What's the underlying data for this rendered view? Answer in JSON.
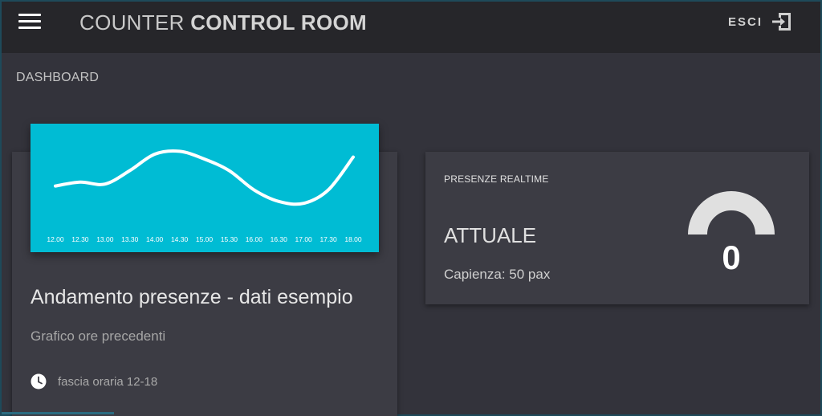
{
  "header": {
    "title_light": "COUNTER",
    "title_bold": "CONTROL ROOM",
    "logout_label": "ESCI"
  },
  "breadcrumb": "DASHBOARD",
  "chart_card": {
    "title": "Andamento presenze - dati esempio",
    "subtitle": "Grafico ore precedenti",
    "footer": "fascia oraria 12-18"
  },
  "realtime_card": {
    "label": "PRESENZE REALTIME",
    "heading": "ATTUALE",
    "capacity": "Capienza: 50 pax",
    "gauge_value": "0",
    "gauge_fraction": 0
  },
  "colors": {
    "accent": "#00bcd4",
    "background": "#33333b",
    "card": "#3c3c44",
    "topbar": "#26262a"
  },
  "chart_data": {
    "type": "line",
    "categories": [
      "12.00",
      "12.30",
      "13.00",
      "13.30",
      "14.00",
      "14.30",
      "15.00",
      "15.30",
      "16.00",
      "16.30",
      "17.00",
      "17.30",
      "18.00"
    ],
    "series": [
      {
        "values": [
          22,
          26,
          24,
          38,
          55,
          58,
          50,
          38,
          18,
          6,
          4,
          18,
          52
        ]
      }
    ],
    "ylim": [
      0,
      70
    ],
    "grid": false,
    "legend": "none"
  }
}
